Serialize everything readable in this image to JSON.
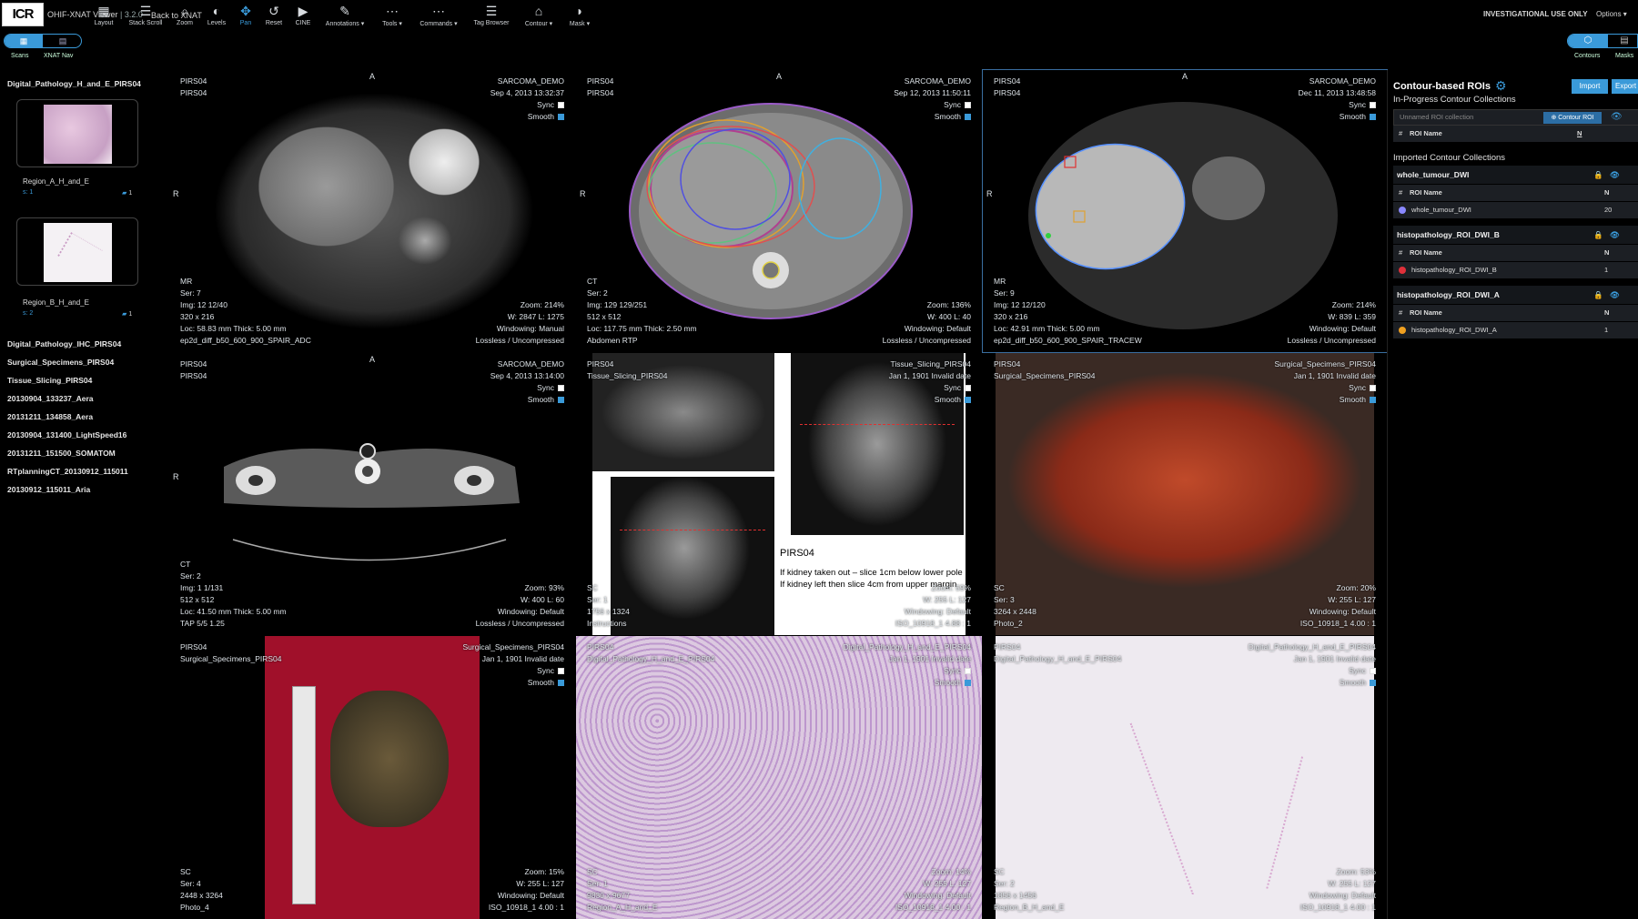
{
  "header": {
    "logo": "ICR",
    "app_title": "OHIF-XNAT Viewer",
    "version": "| 3.2.0",
    "back": "Back to XNAT",
    "investigational": "INVESTIGATIONAL USE ONLY",
    "options": "Options ▾"
  },
  "toolbar": {
    "seg_left": "Scans",
    "seg_right": "XNAT Nav",
    "tools": [
      {
        "icon": "▦",
        "label": "Layout"
      },
      {
        "icon": "☰",
        "label": "Stack Scroll"
      },
      {
        "icon": "⌕",
        "label": "Zoom"
      },
      {
        "icon": "◐",
        "label": "Levels"
      },
      {
        "icon": "✥",
        "label": "Pan"
      },
      {
        "icon": "↺",
        "label": "Reset"
      },
      {
        "icon": "▶",
        "label": "CINE"
      },
      {
        "icon": "✎",
        "label": "Annotations ▾"
      },
      {
        "icon": "⋯",
        "label": "Tools ▾"
      },
      {
        "icon": "⋯",
        "label": "Commands ▾"
      },
      {
        "icon": "☰",
        "label": "Tag Browser"
      },
      {
        "icon": "⌂",
        "label": "Contour ▾"
      },
      {
        "icon": "◗",
        "label": "Mask ▾"
      }
    ],
    "right_tabs": [
      "Contours",
      "Masks"
    ]
  },
  "sidebar": {
    "study1": "Digital_Pathology_H_and_E_PIRS04",
    "thumbs": [
      {
        "label": "Region_A_H_and_E",
        "sub": "s: 1",
        "count": "1"
      },
      {
        "label": "Region_B_H_and_E",
        "sub": "s: 2",
        "count": "1"
      }
    ],
    "series": [
      "Digital_Pathology_IHC_PIRS04",
      "Surgical_Specimens_PIRS04",
      "Tissue_Slicing_PIRS04",
      "20130904_133237_Aera",
      "20131211_134858_Aera",
      "20130904_131400_LightSpeed16",
      "20131211_151500_SOMATOM",
      "RTplanningCT_20130912_115011",
      "20130912_115011_Aria"
    ]
  },
  "viewports": [
    {
      "tl": [
        "PIRS04",
        "PIRS04"
      ],
      "tr": [
        "SARCOMA_DEMO",
        "Sep 4, 2013 13:32:37"
      ],
      "sync": "Sync",
      "smooth": "Smooth",
      "bl": [
        "MR",
        "Ser: 7",
        "Img: 12 12/40",
        "320 x 216",
        "Loc: 58.83 mm Thick: 5.00 mm",
        "ep2d_diff_b50_600_900_SPAIR_ADC"
      ],
      "br": [
        "Zoom: 214%",
        "W: 2847 L: 1275",
        "Windowing: Manual",
        "Lossless / Uncompressed"
      ]
    },
    {
      "tl": [
        "PIRS04",
        "PIRS04"
      ],
      "tr": [
        "SARCOMA_DEMO",
        "Sep 12, 2013 11:50:11"
      ],
      "sync": "Sync",
      "smooth": "Smooth",
      "bl": [
        "CT",
        "Ser: 2",
        "Img: 129 129/251",
        "512 x 512",
        "Loc: 117.75 mm Thick: 2.50 mm",
        "Abdomen RTP"
      ],
      "br": [
        "Zoom: 136%",
        "W: 400 L: 40",
        "Windowing: Default",
        "Lossless / Uncompressed"
      ]
    },
    {
      "tl": [
        "PIRS04",
        "PIRS04"
      ],
      "tr": [
        "SARCOMA_DEMO",
        "Dec 11, 2013 13:48:58"
      ],
      "sync": "Sync",
      "smooth": "Smooth",
      "bl": [
        "MR",
        "Ser: 9",
        "Img: 12 12/120",
        "320 x 216",
        "Loc: 42.91 mm Thick: 5.00 mm",
        "ep2d_diff_b50_600_900_SPAIR_TRACEW"
      ],
      "br": [
        "Zoom: 214%",
        "W: 839 L: 359",
        "Windowing: Default",
        "Lossless / Uncompressed"
      ]
    },
    {
      "tl": [
        "PIRS04",
        "PIRS04"
      ],
      "tr": [
        "SARCOMA_DEMO",
        "Sep 4, 2013 13:14:00"
      ],
      "sync": "Sync",
      "smooth": "Smooth",
      "bl": [
        "CT",
        "Ser: 2",
        "Img: 1 1/131",
        "512 x 512",
        "Loc: 41.50 mm Thick: 5.00 mm",
        "TAP 5/5 1.25"
      ],
      "br": [
        "Zoom: 93%",
        "W: 400 L: 60",
        "Windowing: Default",
        "Lossless / Uncompressed"
      ]
    },
    {
      "tl": [
        "PIRS04",
        "Tissue_Slicing_PIRS04"
      ],
      "tr": [
        "Tissue_Slicing_PIRS04",
        "Jan 1, 1901 Invalid date"
      ],
      "sync": "Sync",
      "smooth": "Smooth",
      "bl": [
        "SC",
        "Ser: 1",
        "1756 x 1324",
        "Instructions"
      ],
      "br": [
        "Zoom: 59%",
        "W: 255 L: 127",
        "Windowing: Default",
        "ISO_10918_1 4.88 : 1"
      ],
      "doc_title": "PIRS04",
      "doc_line1": "If kidney taken out – slice 1cm below lower pole",
      "doc_line2": "If kidney left then slice 4cm from upper margin"
    },
    {
      "tl": [
        "PIRS04",
        "Surgical_Specimens_PIRS04"
      ],
      "tr": [
        "Surgical_Specimens_PIRS04",
        "Jan 1, 1901 Invalid date"
      ],
      "sync": "Sync",
      "smooth": "Smooth",
      "bl": [
        "SC",
        "Ser: 3",
        "3264 x 2448",
        "Photo_2"
      ],
      "br": [
        "Zoom: 20%",
        "W: 255 L: 127",
        "Windowing: Default",
        "ISO_10918_1 4.00 : 1"
      ]
    },
    {
      "tl": [
        "PIRS04",
        "Surgical_Specimens_PIRS04"
      ],
      "tr": [
        "Surgical_Specimens_PIRS04",
        "Jan 1, 1901 Invalid date"
      ],
      "sync": "Sync",
      "smooth": "Smooth",
      "bl": [
        "SC",
        "Ser: 4",
        "2448 x 3264",
        "Photo_4"
      ],
      "br": [
        "Zoom: 15%",
        "W: 255 L: 127",
        "Windowing: Default",
        "ISO_10918_1 4.00 : 1"
      ]
    },
    {
      "tl": [
        "PIRS04",
        "Digital_Pathology_H_and_E_PIRS04"
      ],
      "tr": [
        "Digital_Pathology_H_and_E_PIRS04",
        "Jan 1, 1901 Invalid date"
      ],
      "sync": "Sync",
      "smooth": "Smooth",
      "bl": [
        "SC",
        "Ser: 1",
        "9830 x 9677",
        "Region_A_H_and_E"
      ],
      "br": [
        "Zoom: 14%",
        "W: 255 L: 127",
        "Windowing: Default",
        "ISO_10918_1 4.00 : 1"
      ]
    },
    {
      "tl": [
        "PIRS04",
        "Digital_Pathology_H_and_E_PIRS04"
      ],
      "tr": [
        "Digital_Pathology_H_and_E_PIRS04",
        "Jan 1, 1901 Invalid date"
      ],
      "sync": "Sync",
      "smooth": "Smooth",
      "bl": [
        "SC",
        "Ser: 2",
        "1856 x 1456",
        "Region_B_H_and_E"
      ],
      "br": [
        "Zoom: 53%",
        "W: 255 L: 127",
        "Windowing: Default",
        "ISO_10918_1 4.00 : 1"
      ]
    }
  ],
  "orientation": {
    "top": "A",
    "left": "R"
  },
  "roi_panel": {
    "title": "Contour-based ROIs",
    "import": "Import",
    "export": "Export",
    "in_progress": "In-Progress Contour Collections",
    "unnamed": "Unnamed ROI collection",
    "contour_roi": "Contour ROI",
    "col_hash": "#",
    "col_name": "ROI Name",
    "col_n": "N",
    "imported": "Imported Contour Collections",
    "collections": [
      {
        "name": "whole_tumour_DWI",
        "roi": "whole_tumour_DWI",
        "n": "20",
        "color": "#8a88ff"
      },
      {
        "name": "histopathology_ROI_DWI_B",
        "roi": "histopathology_ROI_DWI_B",
        "n": "1",
        "color": "#e0303a"
      },
      {
        "name": "histopathology_ROI_DWI_A",
        "roi": "histopathology_ROI_DWI_A",
        "n": "1",
        "color": "#f0a020"
      }
    ]
  }
}
